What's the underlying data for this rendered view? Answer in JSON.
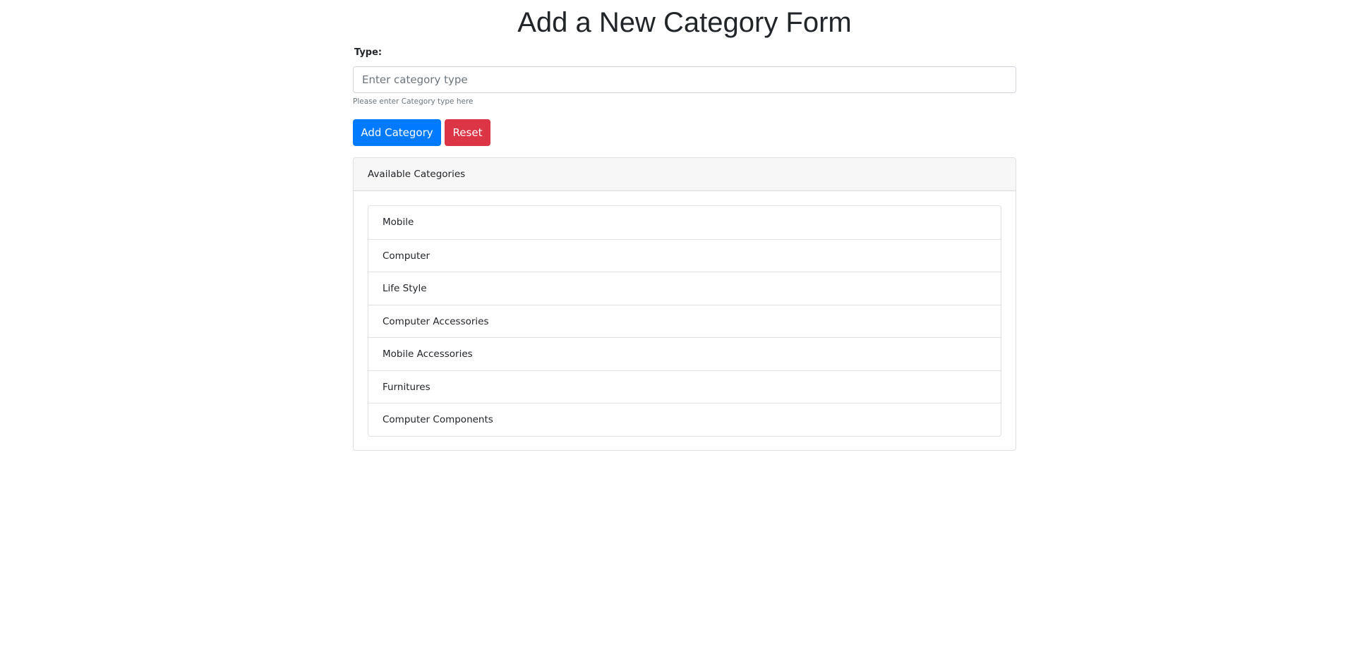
{
  "page": {
    "title": "Add a New Category Form"
  },
  "form": {
    "type_label": "Type:",
    "type_value": "",
    "type_placeholder": "Enter category type",
    "help_text": "Please enter Category type here",
    "add_button_label": "Add Category",
    "reset_button_label": "Reset"
  },
  "categories_panel": {
    "header": "Available Categories",
    "items": [
      "Mobile",
      "Computer",
      "Life Style",
      "Computer Accessories",
      "Mobile Accessories",
      "Furnitures",
      "Computer Components"
    ]
  },
  "colors": {
    "primary": "#007bff",
    "danger": "#dc3545",
    "text": "#212529",
    "muted": "#6c757d"
  }
}
